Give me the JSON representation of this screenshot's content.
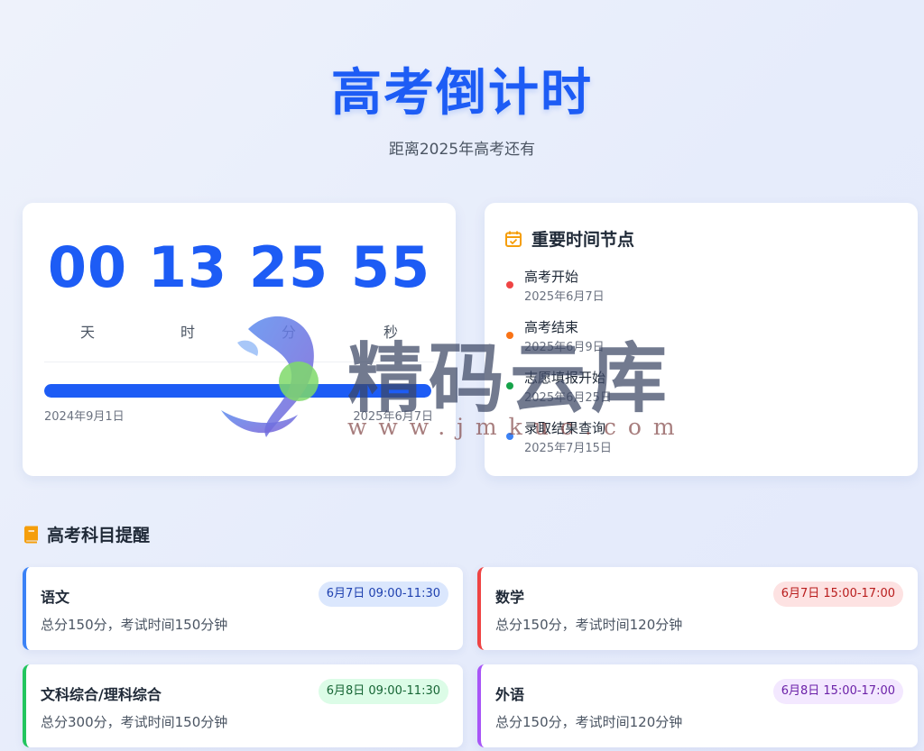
{
  "header": {
    "title": "高考倒计时",
    "subtitle": "距离2025年高考还有"
  },
  "countdown": {
    "units": [
      {
        "value": "00",
        "label": "天"
      },
      {
        "value": "13",
        "label": "时"
      },
      {
        "value": "25",
        "label": "分"
      },
      {
        "value": "55",
        "label": "秒"
      }
    ],
    "progress_percent": 100,
    "start_date": "2024年9月1日",
    "end_date": "2025年6月7日",
    "accent_color": "#1d5cf5"
  },
  "timeline": {
    "title": "重要时间节点",
    "icon": "calendar-check-icon",
    "events": [
      {
        "name": "高考开始",
        "date": "2025年6月7日",
        "color": "#ef4444"
      },
      {
        "name": "高考结束",
        "date": "2025年6月9日",
        "color": "#f97316"
      },
      {
        "name": "志愿填报开始",
        "date": "2025年6月25日",
        "color": "#16a34a"
      },
      {
        "name": "录取结果查询",
        "date": "2025年7月15日",
        "color": "#3b82f6"
      }
    ]
  },
  "subjects": {
    "heading": "高考科目提醒",
    "icon": "book-icon",
    "items": [
      {
        "name": "语文",
        "time": "6月7日 09:00-11:30",
        "desc": "总分150分，考试时间150分钟",
        "color": "#3b82f6",
        "badge_bg": "#dbe7fd",
        "badge_color": "#1e40af"
      },
      {
        "name": "数学",
        "time": "6月7日 15:00-17:00",
        "desc": "总分150分，考试时间120分钟",
        "color": "#ef4444",
        "badge_bg": "#fde2e2",
        "badge_color": "#b91c1c"
      },
      {
        "name": "文科综合/理科综合",
        "time": "6月8日 09:00-11:30",
        "desc": "总分300分，考试时间150分钟",
        "color": "#22c55e",
        "badge_bg": "#dcfce7",
        "badge_color": "#166534"
      },
      {
        "name": "外语",
        "time": "6月8日 15:00-17:00",
        "desc": "总分150分，考试时间120分钟",
        "color": "#a855f7",
        "badge_bg": "#f3e8ff",
        "badge_color": "#6b21a8"
      }
    ]
  },
  "watermark": {
    "text": "精码云库",
    "url": "www.jmkuc.com"
  }
}
